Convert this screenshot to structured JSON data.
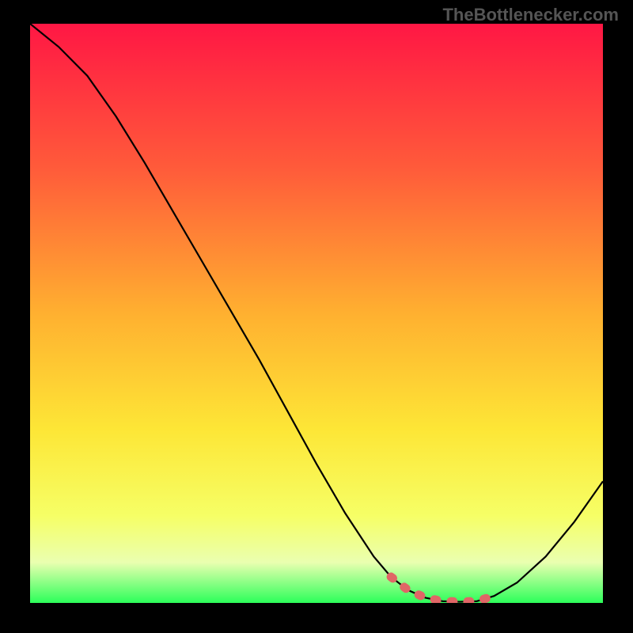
{
  "watermark": "TheBottlenecker.com",
  "chart_data": {
    "type": "line",
    "title": "",
    "xlabel": "",
    "ylabel": "",
    "xlim": [
      0,
      100
    ],
    "ylim": [
      0,
      100
    ],
    "gradient_stops": [
      {
        "offset": 0,
        "color": "#ff1744"
      },
      {
        "offset": 25,
        "color": "#ff5b3a"
      },
      {
        "offset": 50,
        "color": "#ffb030"
      },
      {
        "offset": 70,
        "color": "#fde636"
      },
      {
        "offset": 85,
        "color": "#f6ff66"
      },
      {
        "offset": 93,
        "color": "#eaffb0"
      },
      {
        "offset": 100,
        "color": "#2cff5a"
      }
    ],
    "series": [
      {
        "name": "bottleneck-curve",
        "color": "#000000",
        "x": [
          0,
          5,
          10,
          15,
          20,
          25,
          30,
          35,
          40,
          45,
          50,
          55,
          60,
          63,
          66,
          69,
          72,
          75,
          78,
          81,
          85,
          90,
          95,
          100
        ],
        "y": [
          100,
          96,
          91,
          84,
          76,
          67.5,
          59,
          50.5,
          42,
          33,
          24,
          15.5,
          8,
          4.5,
          2.2,
          0.9,
          0.3,
          0.2,
          0.3,
          1.2,
          3.5,
          8,
          14,
          21
        ]
      }
    ],
    "highlight": {
      "name": "optimal-range",
      "color": "#e06666",
      "x": [
        63,
        66,
        69,
        72,
        75,
        78,
        81
      ],
      "y": [
        4.5,
        2.2,
        0.9,
        0.3,
        0.2,
        0.3,
        1.2
      ]
    }
  }
}
